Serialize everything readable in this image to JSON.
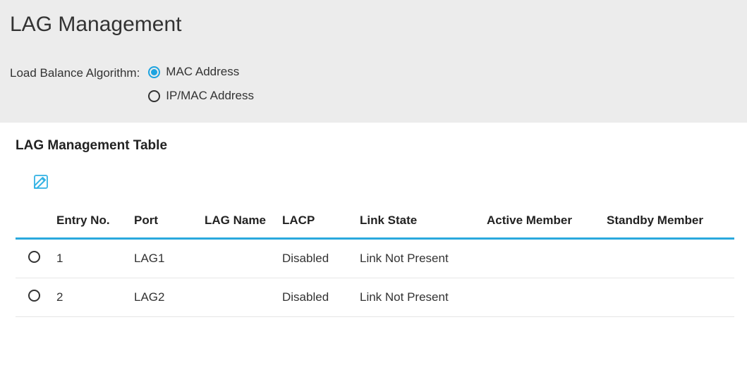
{
  "page": {
    "title": "LAG Management"
  },
  "form": {
    "label": "Load Balance Algorithm:",
    "options": [
      {
        "label": "MAC Address",
        "selected": true
      },
      {
        "label": "IP/MAC Address",
        "selected": false
      }
    ]
  },
  "table": {
    "title": "LAG Management Table",
    "headers": {
      "entry": "Entry No.",
      "port": "Port",
      "lagname": "LAG Name",
      "lacp": "LACP",
      "link": "Link State",
      "active": "Active Member",
      "standby": "Standby Member"
    },
    "rows": [
      {
        "entry": "1",
        "port": "LAG1",
        "lagname": "",
        "lacp": "Disabled",
        "link": "Link Not Present",
        "active": "",
        "standby": ""
      },
      {
        "entry": "2",
        "port": "LAG2",
        "lagname": "",
        "lacp": "Disabled",
        "link": "Link Not Present",
        "active": "",
        "standby": ""
      }
    ]
  }
}
